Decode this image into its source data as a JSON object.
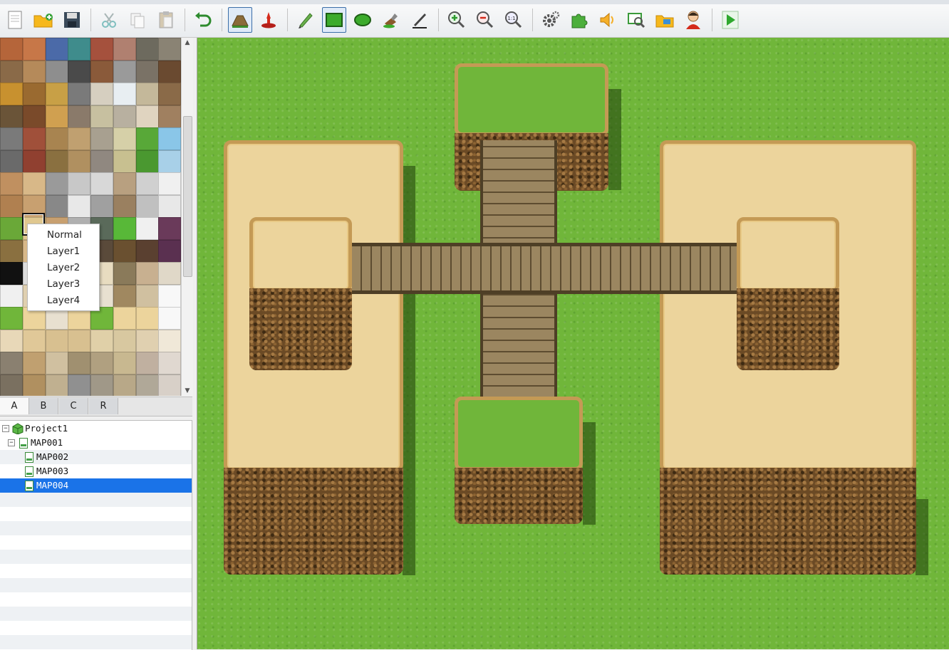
{
  "toolbar": {
    "buttons": [
      {
        "name": "new-project",
        "icon": "new-document-icon"
      },
      {
        "name": "open-project",
        "icon": "open-folder-icon"
      },
      {
        "name": "save-project",
        "icon": "save-disk-icon"
      },
      {
        "name": "cut",
        "icon": "scissors-icon"
      },
      {
        "name": "copy",
        "icon": "copy-icon"
      },
      {
        "name": "paste",
        "icon": "paste-icon"
      },
      {
        "name": "undo",
        "icon": "undo-arrow-icon"
      },
      {
        "name": "map-mode",
        "icon": "map-mode-icon",
        "active": true
      },
      {
        "name": "event-mode",
        "icon": "event-mode-icon"
      },
      {
        "name": "pencil",
        "icon": "pencil-icon"
      },
      {
        "name": "rectangle",
        "icon": "rectangle-icon",
        "active": true
      },
      {
        "name": "ellipse",
        "icon": "ellipse-icon"
      },
      {
        "name": "flood-fill",
        "icon": "fill-bucket-icon"
      },
      {
        "name": "shadow-pen",
        "icon": "shadow-pen-icon"
      },
      {
        "name": "zoom-in",
        "icon": "zoom-in-icon"
      },
      {
        "name": "zoom-out",
        "icon": "zoom-out-icon"
      },
      {
        "name": "zoom-actual",
        "icon": "zoom-1-1-icon",
        "text": "1:1"
      },
      {
        "name": "database",
        "icon": "gear-icon"
      },
      {
        "name": "plugin-manager",
        "icon": "puzzle-icon"
      },
      {
        "name": "sound-test",
        "icon": "speaker-icon"
      },
      {
        "name": "event-searcher",
        "icon": "search-event-icon"
      },
      {
        "name": "resource-manager",
        "icon": "resource-folder-icon"
      },
      {
        "name": "character-generator",
        "icon": "character-face-icon"
      },
      {
        "name": "playtest",
        "icon": "play-icon"
      }
    ]
  },
  "tileset_tabs": [
    "A",
    "B",
    "C",
    "R"
  ],
  "selected_tab": "A",
  "layer_menu": [
    "Normal",
    "Layer1",
    "Layer2",
    "Layer3",
    "Layer4"
  ],
  "tree": {
    "project": "Project1",
    "maps": [
      {
        "name": "MAP001",
        "level": 1
      },
      {
        "name": "MAP002",
        "level": 2
      },
      {
        "name": "MAP003",
        "level": 2
      },
      {
        "name": "MAP004",
        "level": 2,
        "selected": true
      }
    ]
  },
  "colors": {
    "grass": "#70b63a",
    "sand": "#ecd49c",
    "selection": "#1a73e8"
  }
}
